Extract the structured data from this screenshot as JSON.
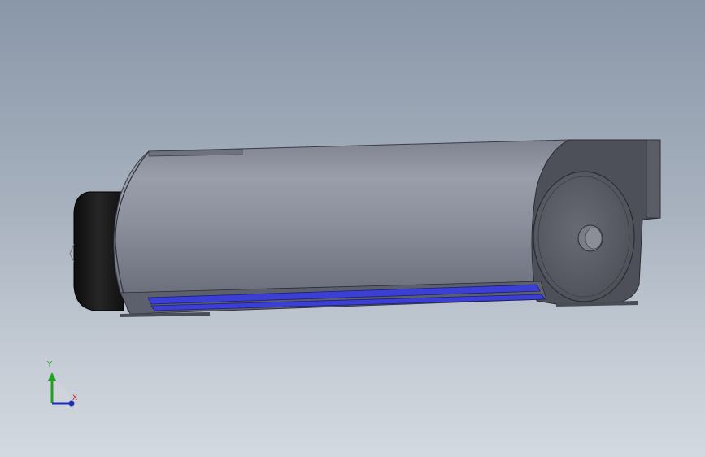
{
  "viewport": {
    "background_top": "#8a97a8",
    "background_bottom": "#d3d9e0"
  },
  "model": {
    "body_color": "#8e929e",
    "end_cap_color": "#4e5059",
    "motor_color": "#151515",
    "accent_color": "#3b3fd6"
  },
  "triad": {
    "y_label": "Y",
    "x_label": "X",
    "colors": {
      "y": "#1fa31f",
      "x": "#c21f1f",
      "z": "#1f2fb3"
    }
  }
}
